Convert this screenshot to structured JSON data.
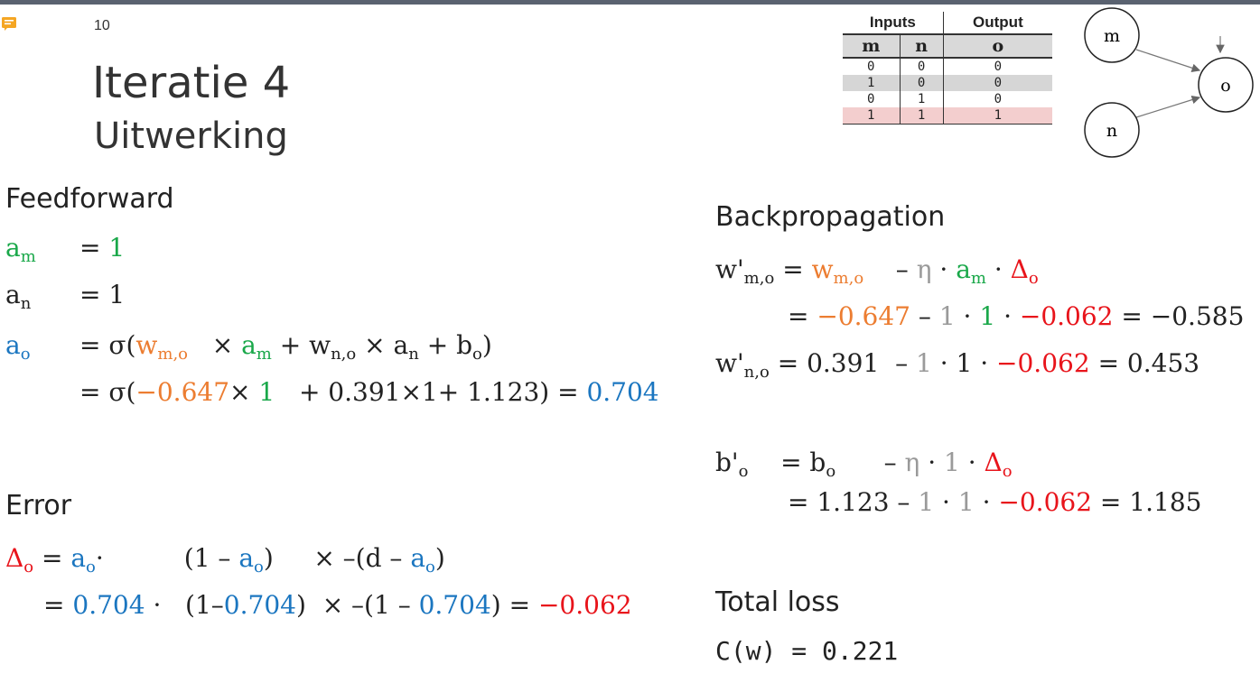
{
  "slide": {
    "number": "10",
    "title": "Iteratie 4",
    "subtitle": "Uitwerking"
  },
  "truth_table": {
    "group_headers": [
      "Inputs",
      "Output"
    ],
    "columns": [
      "m",
      "n",
      "o"
    ],
    "rows": [
      [
        "0",
        "0",
        "0"
      ],
      [
        "1",
        "0",
        "0"
      ],
      [
        "0",
        "1",
        "0"
      ],
      [
        "1",
        "1",
        "1"
      ]
    ]
  },
  "network": {
    "nodes": [
      "m",
      "n",
      "o"
    ]
  },
  "feedforward": {
    "heading": "Feedforward",
    "am_value": "1",
    "an_value": "1",
    "ao_line2": {
      "w_mo": "−0.647",
      "a_m": "1",
      "rest": "+ 0.391×1+ 1.123) =",
      "result": "0.704"
    }
  },
  "error": {
    "heading": "Error",
    "line2": {
      "v1": "0.704",
      "v2": "0.704",
      "v3": "0.704",
      "result": "−0.062"
    }
  },
  "backprop": {
    "heading": "Backpropagation",
    "w_mo_line2": {
      "w": "−0.647",
      "eta": "1",
      "a": "1",
      "delta": "−0.062",
      "result": "= −0.585"
    },
    "w_no": {
      "w": "= 0.391",
      "eta": "1",
      "a": "· 1 ·",
      "delta": "−0.062",
      "result": "= 0.453"
    },
    "b_o_line2": {
      "b": "= 1.123 –",
      "eta": "1",
      "one": "1",
      "delta": "−0.062",
      "result": "= 1.185"
    }
  },
  "loss": {
    "heading": "Total loss",
    "formula": "C(w) = 0.221"
  },
  "colors": {
    "green": "#1aa84a",
    "blue": "#1b76c0",
    "orange": "#ec7d31",
    "red": "#e8141b",
    "gray": "#9a9a9a"
  }
}
